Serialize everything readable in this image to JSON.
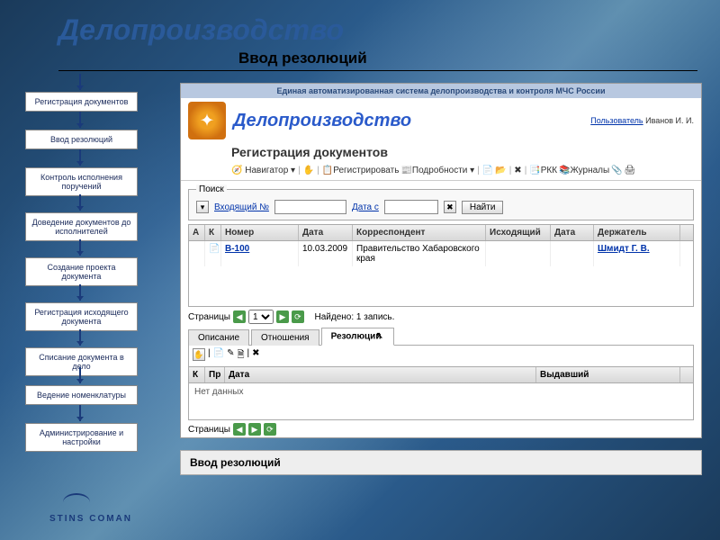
{
  "slide": {
    "main_title": "Делопроизводство",
    "subtitle": "Ввод резолюций",
    "caption": "Ввод резолюций",
    "footer_brand": "STINS COMAN"
  },
  "nav_items": [
    "Регистрация документов",
    "Ввод резолюций",
    "Контроль исполнения поручений",
    "Доведение документов до исполнителей",
    "Создание проекта документа",
    "Регистрация исходящего документа",
    "Списание документа в дело",
    "Ведение номенклатуры",
    "Администрирование и настройки"
  ],
  "app": {
    "system_header": "Единая автоматизированная система делопроизводства и контроля МЧС России",
    "title": "Делопроизводство",
    "user_label": "Пользователь",
    "user_name": "Иванов И. И.",
    "section_title": "Регистрация документов",
    "toolbar": {
      "navigator": "Навигатор",
      "register": "Регистрировать",
      "details": "Подробности",
      "rkk": "РКК",
      "journals": "Журналы"
    },
    "search": {
      "legend": "Поиск",
      "incoming_label": "Входящий №",
      "date_from": "Дата с",
      "find": "Найти"
    },
    "grid": {
      "columns": {
        "a": "А",
        "k": "К",
        "num": "Номер",
        "date": "Дата",
        "corr": "Корреспондент",
        "out": "Исходящий",
        "date2": "Дата",
        "holder": "Держатель"
      },
      "rows": [
        {
          "num": "В-100",
          "date": "10.03.2009",
          "corr": "Правительство Хабаровского края",
          "out": "",
          "date2": "",
          "holder": "Шмидт Г. В."
        }
      ]
    },
    "pager": {
      "pages_label": "Страницы",
      "current": "1",
      "found": "Найдено: 1 запись."
    },
    "tabs": {
      "desc": "Описание",
      "rel": "Отношения",
      "res": "Резолюции"
    },
    "grid2": {
      "columns": {
        "k": "К",
        "pr": "Пр",
        "date": "Дата",
        "issued": "Выдавший"
      },
      "empty": "Нет данных"
    },
    "pager2": {
      "pages_label": "Страницы",
      "refresh": "⟳"
    }
  }
}
